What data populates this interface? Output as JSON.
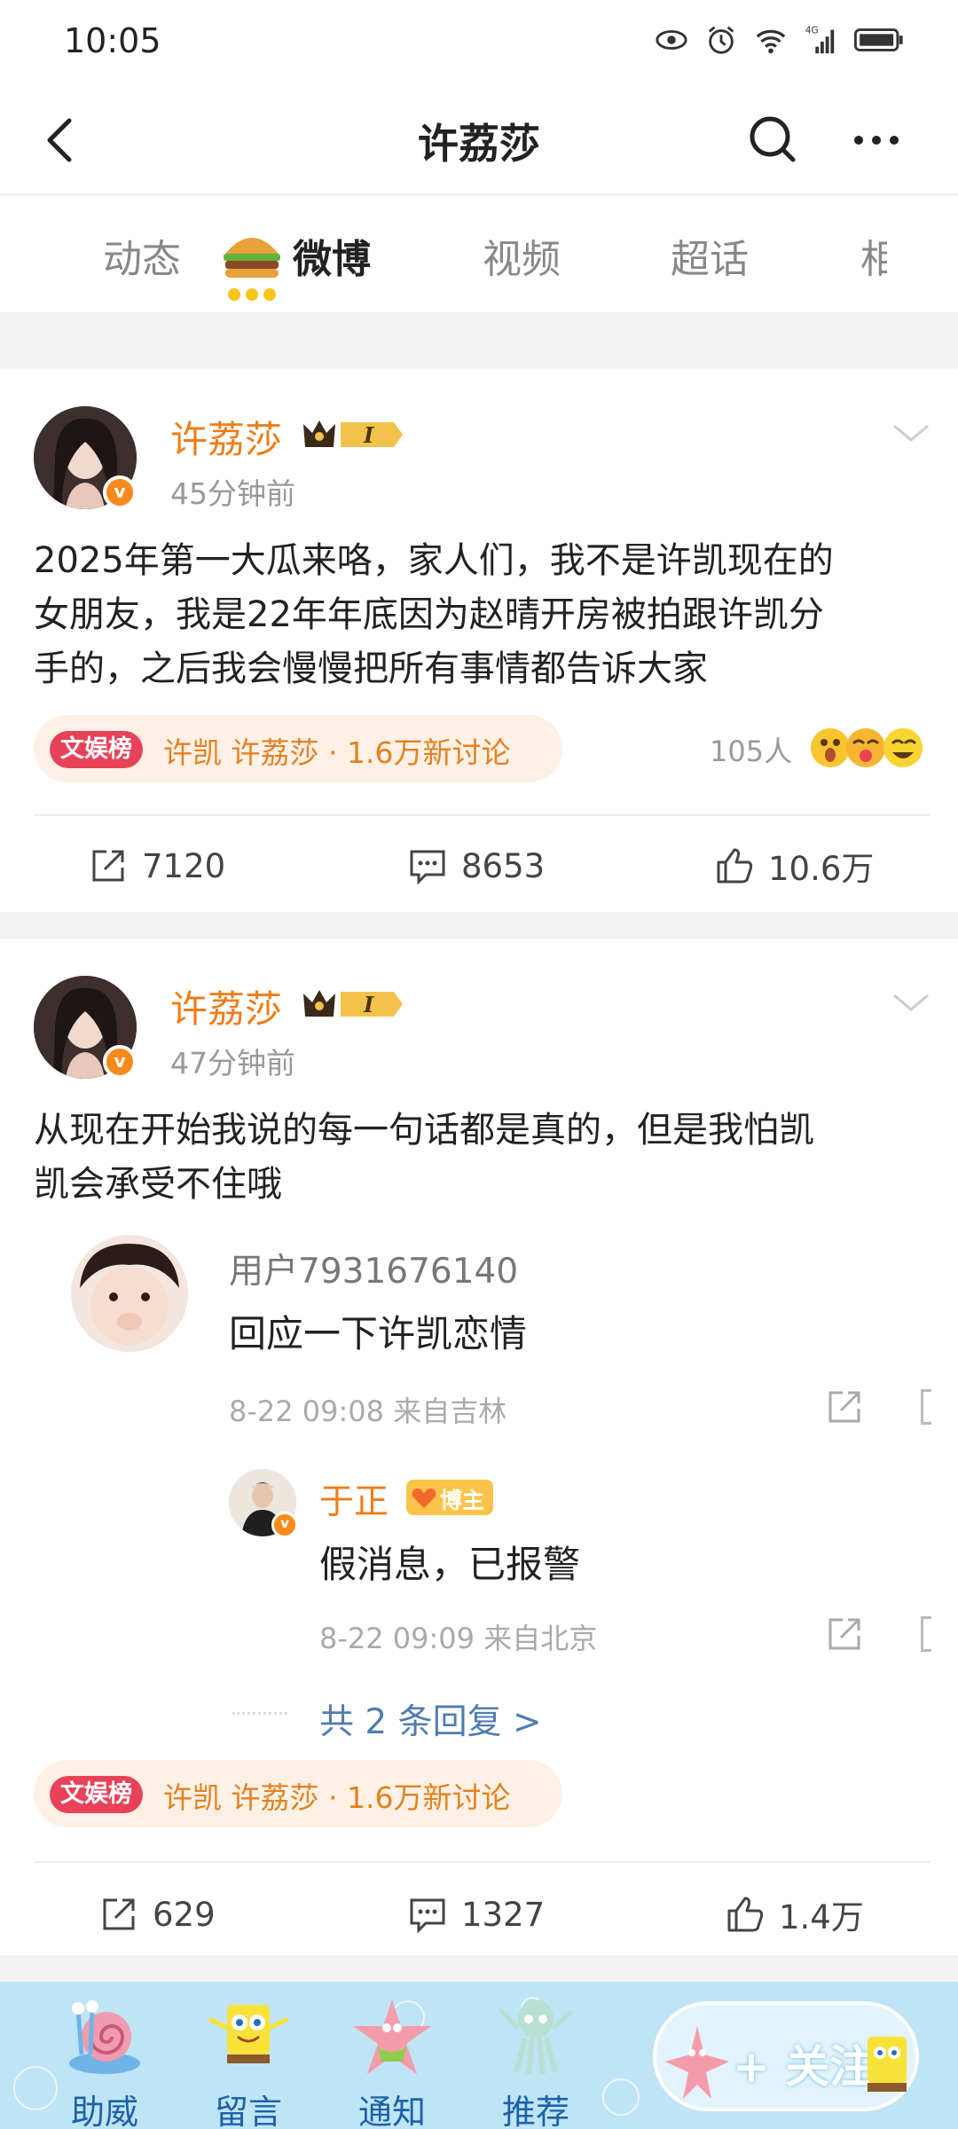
{
  "status_bar": {
    "time": "10:05",
    "network": "4G"
  },
  "nav": {
    "title": "许荔莎"
  },
  "tabs": [
    {
      "label": "动态"
    },
    {
      "label": "微博"
    },
    {
      "label": "视频"
    },
    {
      "label": "超话"
    },
    {
      "label": "相"
    }
  ],
  "posts": [
    {
      "user": "许荔莎",
      "level": "I",
      "time": "45分钟前",
      "text_lines": [
        "2025年第一大瓜来咯，家人们，我不是许凯现在的",
        "女朋友，我是22年年底因为赵晴开房被拍跟许凯分",
        "手的，之后我会慢慢把所有事情都告诉大家"
      ],
      "topic": {
        "label": "文娱榜",
        "text": "许凯 许荔莎 · 1.6万新讨论"
      },
      "reactions": "105人",
      "actions": {
        "share": "7120",
        "comment": "8653",
        "like": "10.6万"
      }
    },
    {
      "user": "许荔莎",
      "level": "I",
      "time": "47分钟前",
      "text_lines": [
        "从现在开始我说的每一句话都是真的，但是我怕凯",
        "凯会承受不住哦"
      ],
      "comment": {
        "user": "用户7931676140",
        "text": "回应一下许凯恋情",
        "meta": "8-22 09:08  来自吉林",
        "reply": {
          "user": "于正",
          "badge": "博主",
          "text": "假消息，已报警",
          "meta": "8-22 09:09  来自北京"
        },
        "reply_count": "共 2 条回复 >"
      },
      "topic": {
        "label": "文娱榜",
        "text": "许凯 许荔莎 · 1.6万新讨论"
      },
      "actions": {
        "share": "629",
        "comment": "1327",
        "like": "1.4万"
      }
    }
  ],
  "bottom_bar": {
    "items": [
      {
        "label": "助威"
      },
      {
        "label": "留言"
      },
      {
        "label": "通知"
      },
      {
        "label": "推荐"
      }
    ],
    "follow": "+ 关注"
  },
  "colors": {
    "accent": "#f07c18",
    "link": "#507daf",
    "topic_red": "#e8425a"
  }
}
